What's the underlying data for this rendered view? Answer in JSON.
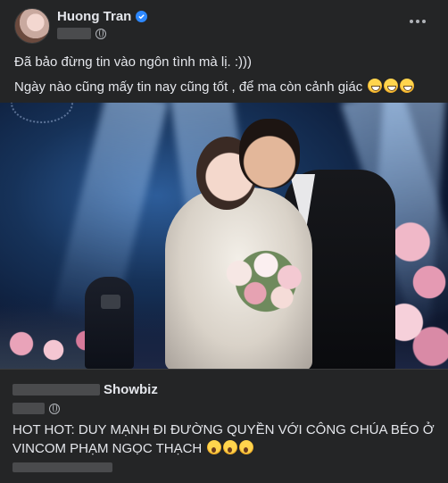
{
  "post": {
    "author": "Huong Tran",
    "line1": "Đã bảo đừng tin vào ngôn tình mà lị. :)))",
    "line2": "Ngày nào cũng mấy tin nay cũng tốt , để ma còn cảnh giác",
    "line2_emojis": [
      "grinning-squint-emoji",
      "grinning-squint-emoji",
      "grinning-squint-emoji"
    ]
  },
  "shared": {
    "page_suffix": "Showbiz",
    "text": "HOT HOT: DUY MẠNH ĐI ĐƯỜNG QUYỀN VỚI CÔNG CHÚA BÉO Ở VINCOM PHẠM NGỌC THẠCH",
    "text_emojis": [
      "astonished-emoji",
      "astonished-emoji",
      "astonished-emoji"
    ]
  },
  "colors": {
    "background": "#242526",
    "text": "#e4e6eb",
    "secondary": "#b0b3b8",
    "verified": "#2d88ff"
  },
  "icons": [
    "verified-badge-icon",
    "globe-icon",
    "more-options-icon"
  ]
}
